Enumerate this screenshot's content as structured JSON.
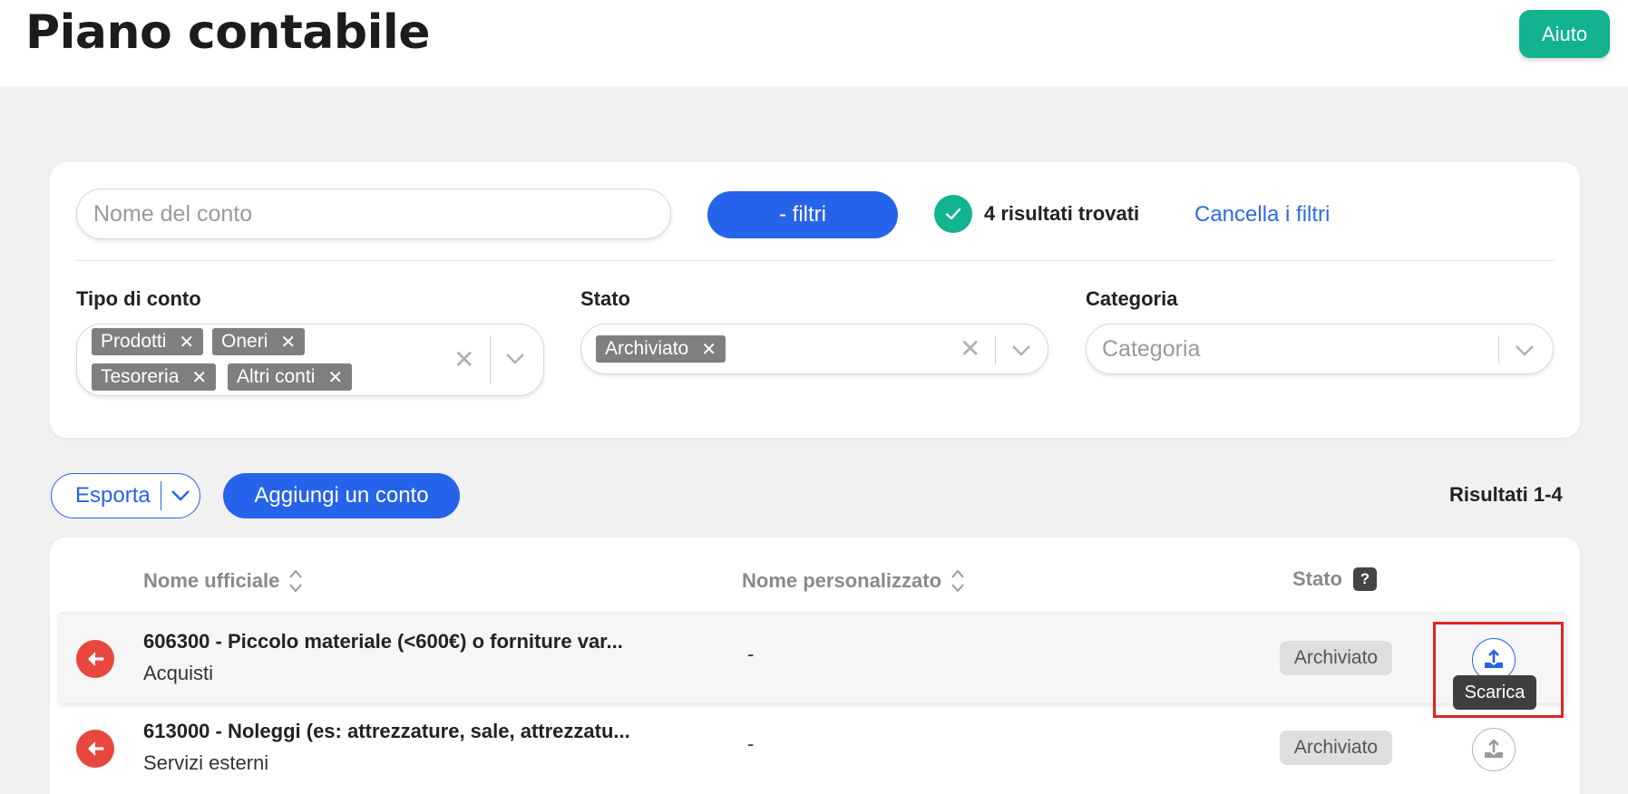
{
  "header": {
    "title": "Piano contabile",
    "help_label": "Aiuto"
  },
  "search": {
    "placeholder": "Nome del conto",
    "filters_button": "- filtri",
    "results_found": "4 risultati trovati",
    "clear_filters": "Cancella i filtri"
  },
  "filters": {
    "account_type": {
      "label": "Tipo di conto",
      "chips": [
        "Prodotti",
        "Oneri",
        "Tesoreria",
        "Altri conti"
      ]
    },
    "status": {
      "label": "Stato",
      "chips": [
        "Archiviato"
      ]
    },
    "category": {
      "label": "Categoria",
      "placeholder": "Categoria"
    }
  },
  "toolbar": {
    "export_label": "Esporta",
    "add_account_label": "Aggiungi un conto",
    "results_range": "Risultati 1-4"
  },
  "table": {
    "columns": {
      "official_name": "Nome ufficiale",
      "custom_name": "Nome personalizzato",
      "status": "Stato",
      "status_help": "?"
    },
    "rows": [
      {
        "title": "606300 - Piccolo materiale (<600€) o forniture var...",
        "subtitle": "Acquisti",
        "custom_name": "-",
        "status": "Archiviato"
      },
      {
        "title": "613000 - Noleggi (es: attrezzature, sale, attrezzatu...",
        "subtitle": "Servizi esterni",
        "custom_name": "-",
        "status": "Archiviato"
      }
    ],
    "tooltip": "Scarica"
  },
  "colors": {
    "primary": "#2563eb",
    "success": "#12b38f",
    "danger": "#e8473d",
    "highlight": "#e02424"
  },
  "icons": [
    "check-icon",
    "clear-icon",
    "chevron-down-icon",
    "sort-icon",
    "arrow-left-icon",
    "upload-icon"
  ]
}
